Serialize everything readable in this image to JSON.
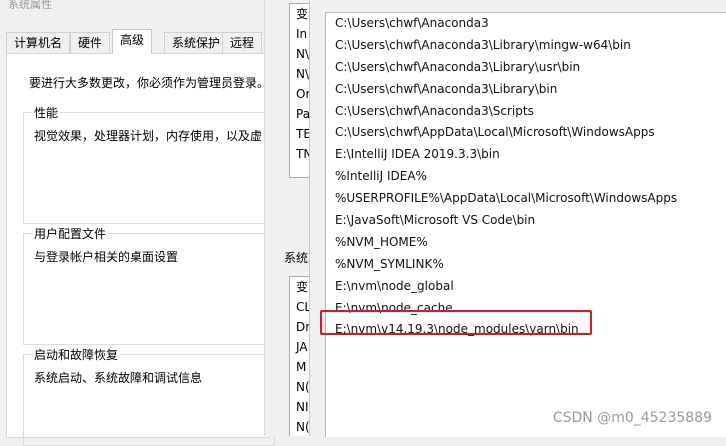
{
  "system_properties": {
    "title": "系统属性",
    "tabs": [
      "计算机名",
      "硬件",
      "高级",
      "系统保护",
      "远程"
    ],
    "active_tab": "高级",
    "admin_message": "要进行大多数更改，你必须作为管理员登录。",
    "groups": [
      {
        "title": "性能",
        "description": "视觉效果，处理器计划，内存使用，以及虚"
      },
      {
        "title": "用户配置文件",
        "description": "与登录帐户相关的桌面设置"
      },
      {
        "title": "启动和故障恢复",
        "description": "系统启动、系统故障和调试信息"
      }
    ]
  },
  "environment_variables": {
    "user_vars": [
      "变",
      "In",
      "N\\",
      "N\\",
      "Or",
      "Pa",
      "TE",
      "TN"
    ],
    "system_section_label": "系统",
    "system_vars": [
      "变",
      "CL",
      "Dr",
      "JA",
      "M",
      "N(",
      "NI",
      "N("
    ]
  },
  "edit_path": {
    "entries": [
      "C:\\Users\\chwf\\Anaconda3",
      "C:\\Users\\chwf\\Anaconda3\\Library\\mingw-w64\\bin",
      "C:\\Users\\chwf\\Anaconda3\\Library\\usr\\bin",
      "C:\\Users\\chwf\\Anaconda3\\Library\\bin",
      "C:\\Users\\chwf\\Anaconda3\\Scripts",
      "C:\\Users\\chwf\\AppData\\Local\\Microsoft\\WindowsApps",
      "E:\\IntelliJ IDEA 2019.3.3\\bin",
      "%IntelliJ IDEA%",
      "%USERPROFILE%\\AppData\\Local\\Microsoft\\WindowsApps",
      "E:\\JavaSoft\\Microsoft VS Code\\bin",
      "%NVM_HOME%",
      "%NVM_SYMLINK%",
      "E:\\nvm\\node_global",
      "E:\\nvm\\node_cache",
      "E:\\nvm\\v14.19.3\\node_modules\\yarn\\bin"
    ],
    "highlighted_entry": "E:\\nvm\\v14.19.3\\node_modules\\yarn\\bin",
    "highlight_color": "#e0161e"
  },
  "watermark": "CSDN @m0_45235889"
}
